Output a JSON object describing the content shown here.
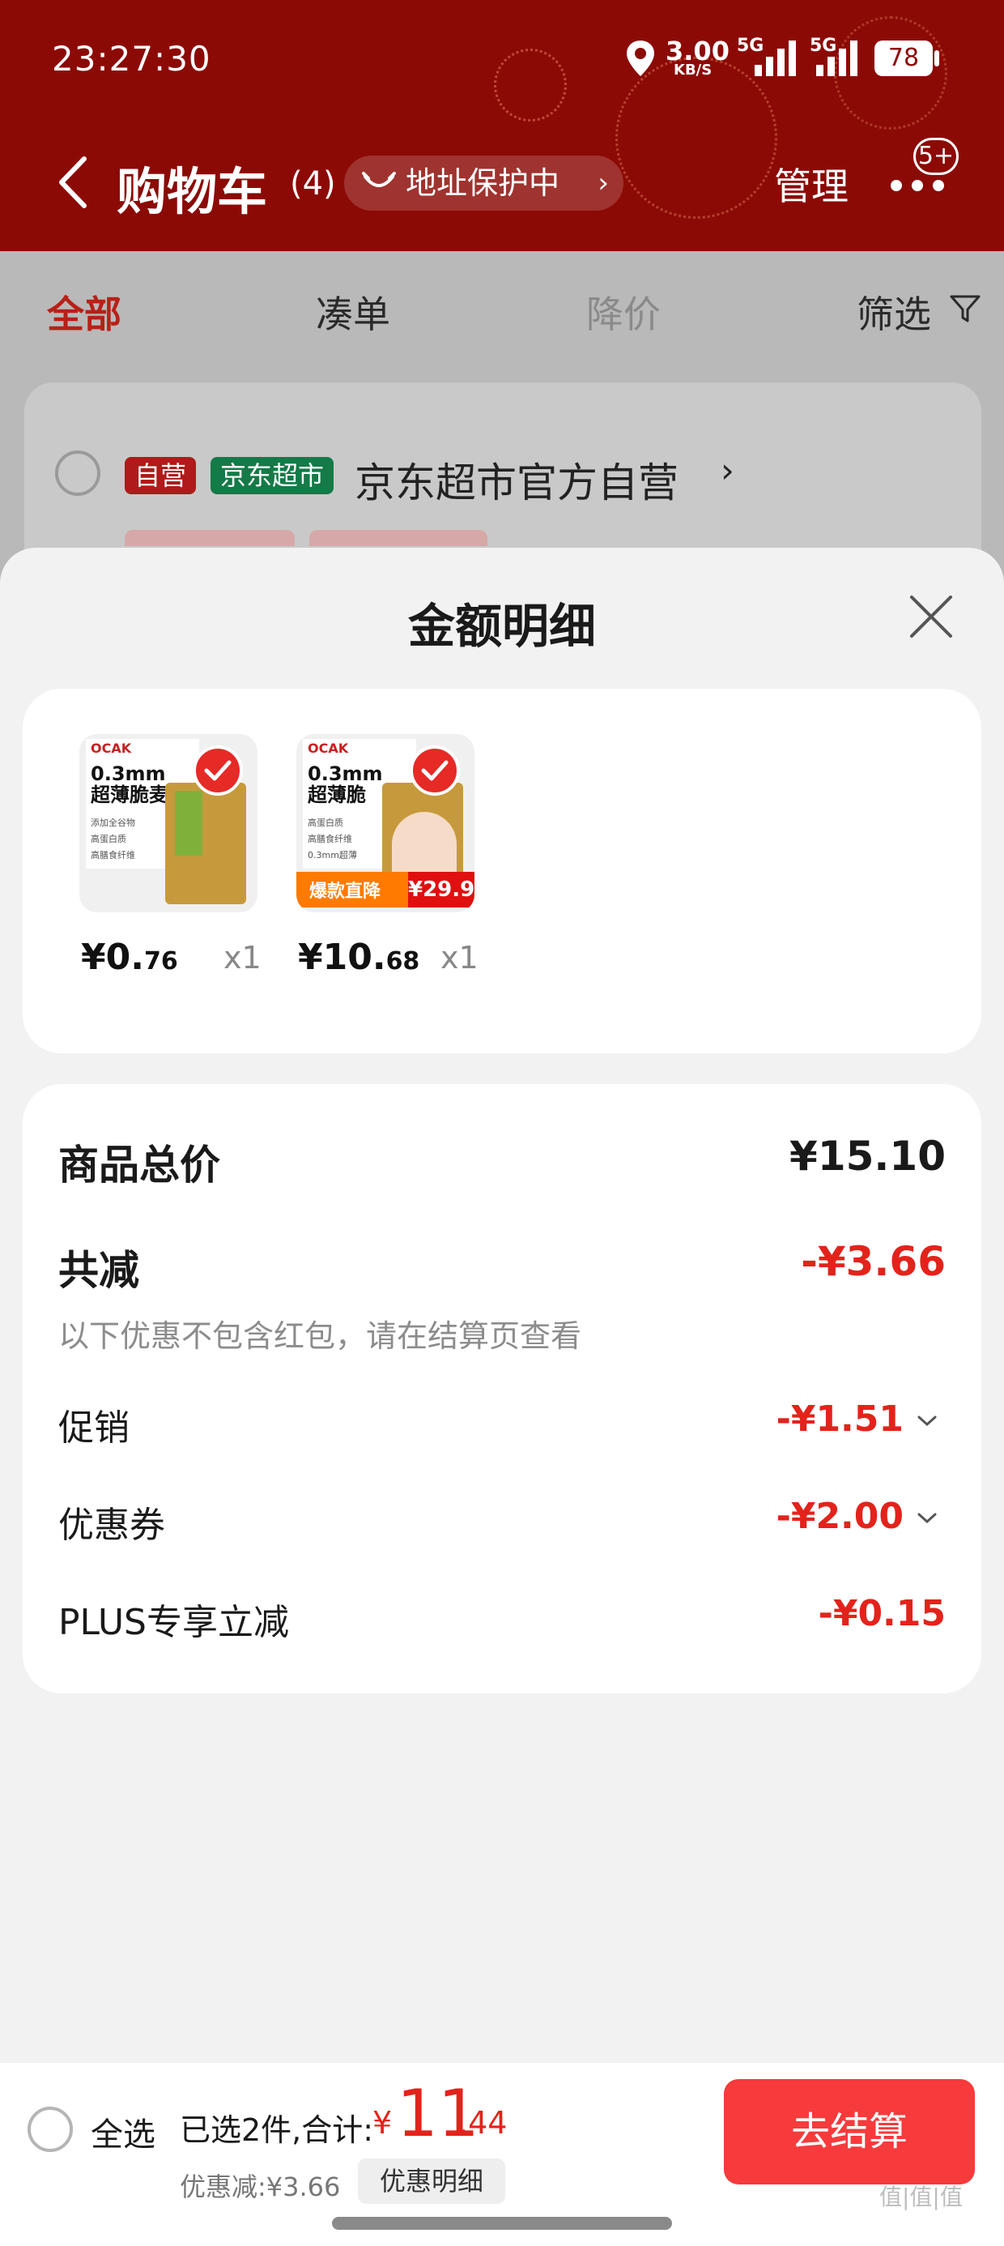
{
  "status_bar": {
    "time": "23:27:30",
    "net_speed": "3.00",
    "net_unit": "KB/S",
    "sig1_label": "5G",
    "sig2_label": "5G",
    "battery": "78"
  },
  "nav": {
    "title": "购物车",
    "count": "(4)",
    "address_protect": "地址保护中",
    "manage": "管理",
    "badge": "5+"
  },
  "tabs": [
    {
      "label": "全部",
      "active": true
    },
    {
      "label": "凑单",
      "active": false
    },
    {
      "label": "降价",
      "active": false
    },
    {
      "label": "筛选",
      "active": false
    }
  ],
  "store": {
    "tag_self": "自营",
    "tag_market": "京东超市",
    "name": "京东超市官方自营"
  },
  "sheet": {
    "title": "金额明细",
    "products": [
      {
        "brand": "OCAK",
        "spec": "0.3mm\n超薄脆麦片",
        "lines": "添加全谷物\n高蛋白质\n高膳食纤维",
        "price_int": "¥0.",
        "price_dec": "76",
        "qty": "x1"
      },
      {
        "brand": "OCAK",
        "spec": "0.3mm\n超薄脆",
        "lines": "高蛋白质\n高膳食纤维\n0.3mm超薄",
        "promo": "爆款直降",
        "promo_price": "¥29.9",
        "price_int": "¥10.",
        "price_dec": "68",
        "qty": "x1"
      }
    ],
    "summary": {
      "total_label": "商品总价",
      "total_value": "¥15.10",
      "reduce_label": "共减",
      "reduce_value": "-¥3.66",
      "note": "以下优惠不包含红包，请在结算页查看",
      "items": [
        {
          "label": "促销",
          "value": "-¥1.51",
          "expandable": true
        },
        {
          "label": "优惠券",
          "value": "-¥2.00",
          "expandable": true
        },
        {
          "label": "PLUS专享立减",
          "value": "-¥0.15",
          "expandable": false
        }
      ]
    }
  },
  "bottom_bar": {
    "select_all": "全选",
    "selected_info": "已选2件,合计:",
    "total_currency": "¥",
    "total_int": "11",
    "total_dec": ".44",
    "discount_line": "优惠减:¥3.66",
    "discount_detail_btn": "优惠明细",
    "checkout": "去结算"
  },
  "watermark": "值|值|值",
  "colors": {
    "header_red": "#8c0a06",
    "accent_red": "#e3231b",
    "checkout_red": "#f73a3c",
    "tag_red": "#e21e1e",
    "tag_green": "#16a15a"
  }
}
